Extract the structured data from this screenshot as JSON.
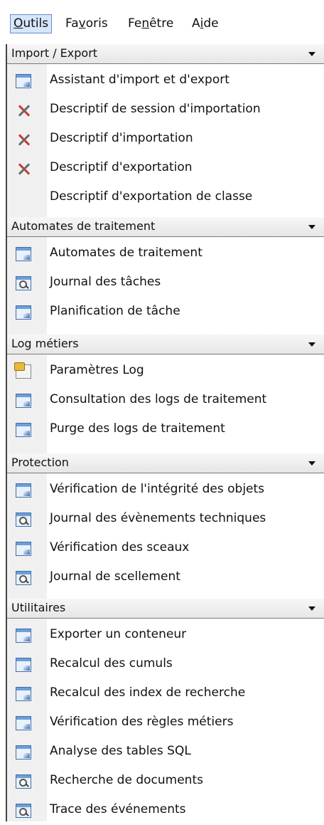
{
  "menubar": {
    "items": [
      {
        "pre": "",
        "u": "O",
        "post": "utils"
      },
      {
        "pre": "Fa",
        "u": "v",
        "post": "oris"
      },
      {
        "pre": "Fe",
        "u": "n",
        "post": "être"
      },
      {
        "pre": "A",
        "u": "i",
        "post": "de"
      }
    ]
  },
  "sections": [
    {
      "title": "Import / Export",
      "items": [
        {
          "label": "Assistant d'import et d'export",
          "icon": "window-icon"
        },
        {
          "label": "Descriptif de session d'importation",
          "icon": "tools-icon"
        },
        {
          "label": "Descriptif d'importation",
          "icon": "tools-icon"
        },
        {
          "label": "Descriptif d'exportation",
          "icon": "tools-icon"
        },
        {
          "label": "Descriptif d'exportation de classe",
          "icon": "none"
        }
      ]
    },
    {
      "title": "Automates de traitement",
      "items": [
        {
          "label": "Automates de traitement",
          "icon": "window-icon"
        },
        {
          "label": "Journal des tâches",
          "icon": "search-icon"
        },
        {
          "label": "Planification de tâche",
          "icon": "window-icon"
        }
      ]
    },
    {
      "title": "Log métiers",
      "items": [
        {
          "label": "Paramètres Log",
          "icon": "settings-icon"
        },
        {
          "label": "Consultation des logs de traitement",
          "icon": "window-icon"
        },
        {
          "label": "Purge des logs de traitement",
          "icon": "window-icon"
        }
      ]
    },
    {
      "title": "Protection",
      "items": [
        {
          "label": "Vérification de l'intégrité des objets",
          "icon": "window-icon"
        },
        {
          "label": "Journal des évènements techniques",
          "icon": "search-icon"
        },
        {
          "label": "Vérification des sceaux",
          "icon": "window-icon"
        },
        {
          "label": "Journal de scellement",
          "icon": "search-icon"
        }
      ]
    },
    {
      "title": "Utilitaires",
      "items": [
        {
          "label": "Exporter un conteneur",
          "icon": "window-icon"
        },
        {
          "label": "Recalcul des cumuls",
          "icon": "window-icon"
        },
        {
          "label": "Recalcul des index de recherche",
          "icon": "window-icon"
        },
        {
          "label": "Vérification des règles métiers",
          "icon": "window-icon"
        },
        {
          "label": "Analyse des tables SQL",
          "icon": "window-icon"
        },
        {
          "label": "Recherche de documents",
          "icon": "search-icon"
        },
        {
          "label": "Trace des événements",
          "icon": "search-icon"
        }
      ]
    }
  ]
}
